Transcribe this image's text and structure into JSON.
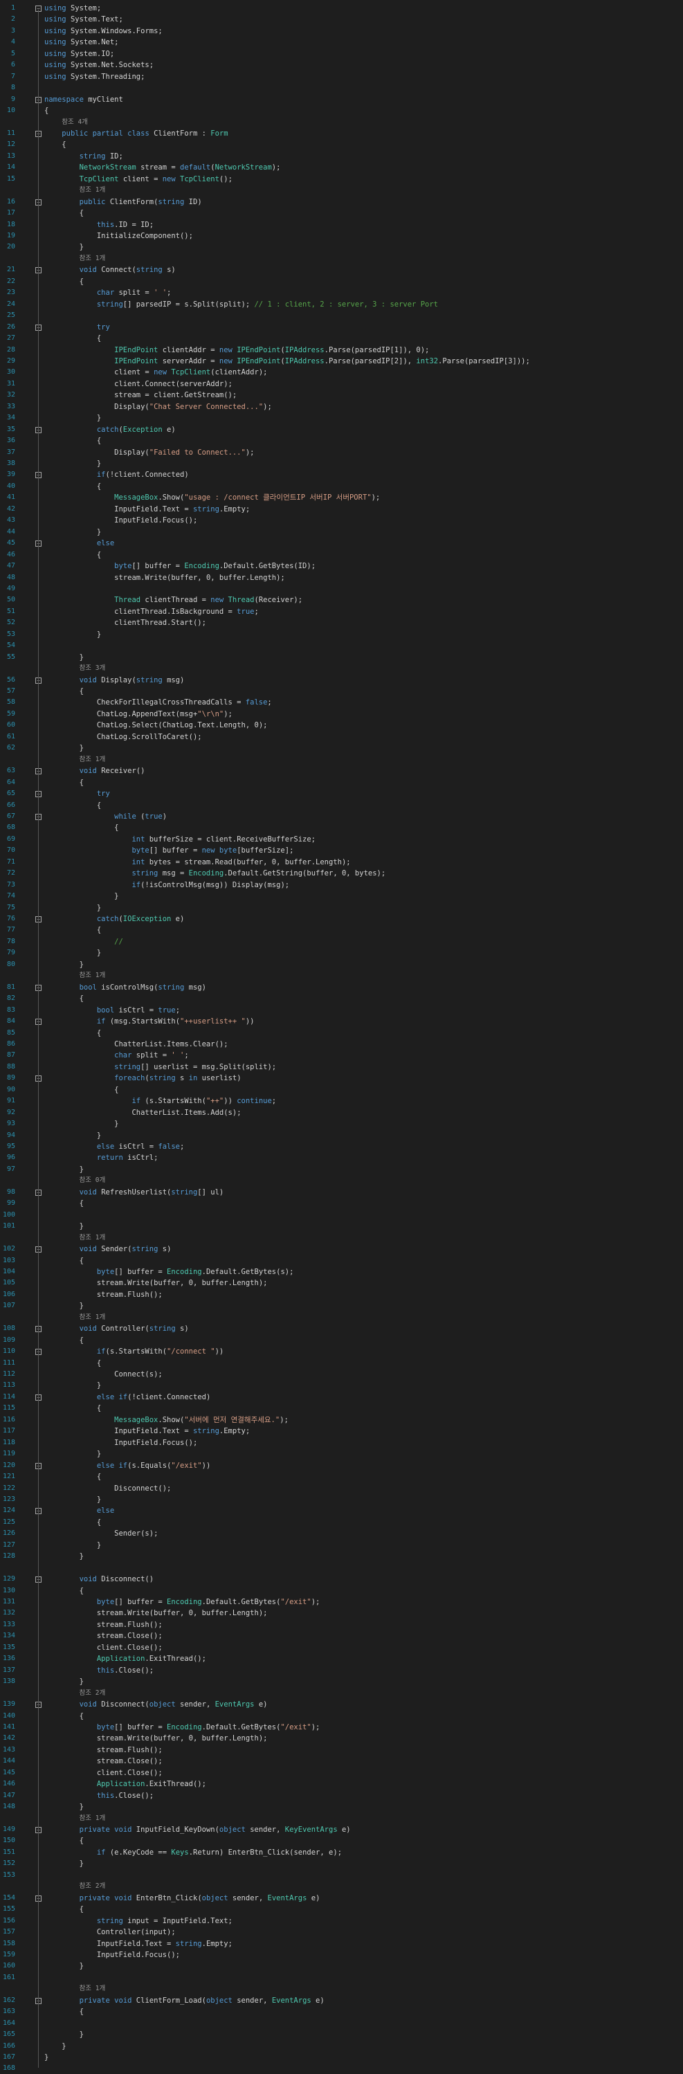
{
  "editor": {
    "colors": {
      "background": "#1e1e1e",
      "line_number": "#2b91af",
      "keyword": "#569cd6",
      "type": "#4ec9b0",
      "string": "#d69d85",
      "comment": "#57a64a",
      "method": "#dcdcaa",
      "text": "#d4d4d4",
      "ref_hint": "#999999"
    },
    "lines": [
      {
        "n": "1",
        "fold": "minus",
        "code": "using System;"
      },
      {
        "n": "2",
        "code": "using System.Text;"
      },
      {
        "n": "3",
        "code": "using System.Windows.Forms;"
      },
      {
        "n": "4",
        "code": "using System.Net;"
      },
      {
        "n": "5",
        "code": "using System.IO;"
      },
      {
        "n": "6",
        "code": "using System.Net.Sockets;"
      },
      {
        "n": "7",
        "code": "using System.Threading;"
      },
      {
        "n": "8",
        "code": ""
      },
      {
        "n": "9",
        "fold": "minus",
        "code": "namespace myClient"
      },
      {
        "n": "10",
        "code": "{"
      },
      {
        "n": "",
        "ref": "참조 4개",
        "indent": 1
      },
      {
        "n": "11",
        "fold": "minus",
        "code": "    public partial class ClientForm : Form"
      },
      {
        "n": "12",
        "code": "    {"
      },
      {
        "n": "13",
        "code": "        string ID;"
      },
      {
        "n": "14",
        "code": "        NetworkStream stream = default(NetworkStream);"
      },
      {
        "n": "15",
        "code": "        TcpClient client = new TcpClient();"
      },
      {
        "n": "",
        "ref": "참조 1개",
        "indent": 2
      },
      {
        "n": "16",
        "fold": "minus",
        "code": "        public ClientForm(string ID)"
      },
      {
        "n": "17",
        "code": "        {"
      },
      {
        "n": "18",
        "code": "            this.ID = ID;"
      },
      {
        "n": "19",
        "code": "            InitializeComponent();"
      },
      {
        "n": "20",
        "code": "        }"
      },
      {
        "n": "",
        "ref": "참조 1개",
        "indent": 2
      },
      {
        "n": "21",
        "fold": "minus",
        "code": "        void Connect(string s)"
      },
      {
        "n": "22",
        "code": "        {"
      },
      {
        "n": "23",
        "code": "            char split = ' ';"
      },
      {
        "n": "24",
        "code": "            string[] parsedIP = s.Split(split); // 1 : client, 2 : server, 3 : server Port"
      },
      {
        "n": "25",
        "code": ""
      },
      {
        "n": "26",
        "fold": "minus",
        "code": "            try"
      },
      {
        "n": "27",
        "code": "            {"
      },
      {
        "n": "28",
        "code": "                IPEndPoint clientAddr = new IPEndPoint(IPAddress.Parse(parsedIP[1]), 0);"
      },
      {
        "n": "29",
        "code": "                IPEndPoint serverAddr = new IPEndPoint(IPAddress.Parse(parsedIP[2]), int32.Parse(parsedIP[3]));"
      },
      {
        "n": "30",
        "code": "                client = new TcpClient(clientAddr);"
      },
      {
        "n": "31",
        "code": "                client.Connect(serverAddr);"
      },
      {
        "n": "32",
        "code": "                stream = client.GetStream();"
      },
      {
        "n": "33",
        "code": "                Display(\"Chat Server Connected...\");"
      },
      {
        "n": "34",
        "code": "            }"
      },
      {
        "n": "35",
        "fold": "minus",
        "code": "            catch(Exception e)"
      },
      {
        "n": "36",
        "code": "            {"
      },
      {
        "n": "37",
        "code": "                Display(\"Failed to Connect...\");"
      },
      {
        "n": "38",
        "code": "            }"
      },
      {
        "n": "39",
        "fold": "minus",
        "code": "            if(!client.Connected)"
      },
      {
        "n": "40",
        "code": "            {"
      },
      {
        "n": "41",
        "code": "                MessageBox.Show(\"usage : /connect 클라이언트IP 서버IP 서버PORT\");"
      },
      {
        "n": "42",
        "code": "                InputField.Text = string.Empty;"
      },
      {
        "n": "43",
        "code": "                InputField.Focus();"
      },
      {
        "n": "44",
        "code": "            }"
      },
      {
        "n": "45",
        "fold": "minus",
        "code": "            else"
      },
      {
        "n": "46",
        "code": "            {"
      },
      {
        "n": "47",
        "code": "                byte[] buffer = Encoding.Default.GetBytes(ID);"
      },
      {
        "n": "48",
        "code": "                stream.Write(buffer, 0, buffer.Length);"
      },
      {
        "n": "49",
        "code": ""
      },
      {
        "n": "50",
        "code": "                Thread clientThread = new Thread(Receiver);"
      },
      {
        "n": "51",
        "code": "                clientThread.IsBackground = true;"
      },
      {
        "n": "52",
        "code": "                clientThread.Start();"
      },
      {
        "n": "53",
        "code": "            }"
      },
      {
        "n": "54",
        "code": ""
      },
      {
        "n": "55",
        "code": "        }"
      },
      {
        "n": "",
        "ref": "참조 3개",
        "indent": 2
      },
      {
        "n": "56",
        "fold": "minus",
        "code": "        void Display(string msg)"
      },
      {
        "n": "57",
        "code": "        {"
      },
      {
        "n": "58",
        "code": "            CheckForIllegalCrossThreadCalls = false;"
      },
      {
        "n": "59",
        "code": "            ChatLog.AppendText(msg+\"\\r\\n\");"
      },
      {
        "n": "60",
        "code": "            ChatLog.Select(ChatLog.Text.Length, 0);"
      },
      {
        "n": "61",
        "code": "            ChatLog.ScrollToCaret();"
      },
      {
        "n": "62",
        "code": "        }"
      },
      {
        "n": "",
        "ref": "참조 1개",
        "indent": 2
      },
      {
        "n": "63",
        "fold": "minus",
        "code": "        void Receiver()"
      },
      {
        "n": "64",
        "code": "        {"
      },
      {
        "n": "65",
        "fold": "minus",
        "code": "            try"
      },
      {
        "n": "66",
        "code": "            {"
      },
      {
        "n": "67",
        "fold": "minus",
        "code": "                while (true)"
      },
      {
        "n": "68",
        "code": "                {"
      },
      {
        "n": "69",
        "code": "                    int bufferSize = client.ReceiveBufferSize;"
      },
      {
        "n": "70",
        "code": "                    byte[] buffer = new byte[bufferSize];"
      },
      {
        "n": "71",
        "code": "                    int bytes = stream.Read(buffer, 0, buffer.Length);"
      },
      {
        "n": "72",
        "code": "                    string msg = Encoding.Default.GetString(buffer, 0, bytes);"
      },
      {
        "n": "73",
        "code": "                    if(!isControlMsg(msg)) Display(msg);"
      },
      {
        "n": "74",
        "code": "                }"
      },
      {
        "n": "75",
        "code": "            }"
      },
      {
        "n": "76",
        "fold": "minus",
        "code": "            catch(IOException e)"
      },
      {
        "n": "77",
        "code": "            {"
      },
      {
        "n": "78",
        "code": "                //"
      },
      {
        "n": "79",
        "code": "            }"
      },
      {
        "n": "80",
        "code": "        }"
      },
      {
        "n": "",
        "ref": "참조 1개",
        "indent": 2
      },
      {
        "n": "81",
        "fold": "minus",
        "code": "        bool isControlMsg(string msg)"
      },
      {
        "n": "82",
        "code": "        {"
      },
      {
        "n": "83",
        "code": "            bool isCtrl = true;"
      },
      {
        "n": "84",
        "fold": "minus",
        "code": "            if (msg.StartsWith(\"++userlist++ \"))"
      },
      {
        "n": "85",
        "code": "            {"
      },
      {
        "n": "86",
        "code": "                ChatterList.Items.Clear();"
      },
      {
        "n": "87",
        "code": "                char split = ' ';"
      },
      {
        "n": "88",
        "code": "                string[] userlist = msg.Split(split);"
      },
      {
        "n": "89",
        "fold": "minus",
        "code": "                foreach(string s in userlist)"
      },
      {
        "n": "90",
        "code": "                {"
      },
      {
        "n": "91",
        "code": "                    if (s.StartsWith(\"++\")) continue;"
      },
      {
        "n": "92",
        "code": "                    ChatterList.Items.Add(s);"
      },
      {
        "n": "93",
        "code": "                }"
      },
      {
        "n": "94",
        "code": "            }"
      },
      {
        "n": "95",
        "code": "            else isCtrl = false;"
      },
      {
        "n": "96",
        "code": "            return isCtrl;"
      },
      {
        "n": "97",
        "code": "        }"
      },
      {
        "n": "",
        "ref": "참조 0개",
        "indent": 2
      },
      {
        "n": "98",
        "fold": "minus",
        "code": "        void RefreshUserlist(string[] ul)"
      },
      {
        "n": "99",
        "code": "        {"
      },
      {
        "n": "100",
        "code": ""
      },
      {
        "n": "101",
        "code": "        }"
      },
      {
        "n": "",
        "ref": "참조 1개",
        "indent": 2
      },
      {
        "n": "102",
        "fold": "minus",
        "code": "        void Sender(string s)"
      },
      {
        "n": "103",
        "code": "        {"
      },
      {
        "n": "104",
        "code": "            byte[] buffer = Encoding.Default.GetBytes(s);"
      },
      {
        "n": "105",
        "code": "            stream.Write(buffer, 0, buffer.Length);"
      },
      {
        "n": "106",
        "code": "            stream.Flush();"
      },
      {
        "n": "107",
        "code": "        }"
      },
      {
        "n": "",
        "ref": "참조 1개",
        "indent": 2
      },
      {
        "n": "108",
        "fold": "minus",
        "code": "        void Controller(string s)"
      },
      {
        "n": "109",
        "code": "        {"
      },
      {
        "n": "110",
        "fold": "minus",
        "code": "            if(s.StartsWith(\"/connect \"))"
      },
      {
        "n": "111",
        "code": "            {"
      },
      {
        "n": "112",
        "code": "                Connect(s);"
      },
      {
        "n": "113",
        "code": "            }"
      },
      {
        "n": "114",
        "fold": "minus",
        "code": "            else if(!client.Connected)"
      },
      {
        "n": "115",
        "code": "            {"
      },
      {
        "n": "116",
        "code": "                MessageBox.Show(\"서버에 먼저 연결해주세요.\");"
      },
      {
        "n": "117",
        "code": "                InputField.Text = string.Empty;"
      },
      {
        "n": "118",
        "code": "                InputField.Focus();"
      },
      {
        "n": "119",
        "code": "            }"
      },
      {
        "n": "120",
        "fold": "minus",
        "code": "            else if(s.Equals(\"/exit\"))"
      },
      {
        "n": "121",
        "code": "            {"
      },
      {
        "n": "122",
        "code": "                Disconnect();"
      },
      {
        "n": "123",
        "code": "            }"
      },
      {
        "n": "124",
        "fold": "minus",
        "code": "            else"
      },
      {
        "n": "125",
        "code": "            {"
      },
      {
        "n": "126",
        "code": "                Sender(s);"
      },
      {
        "n": "127",
        "code": "            }"
      },
      {
        "n": "128",
        "code": "        }"
      },
      {
        "n": "",
        "ref": "",
        "indent": 2
      },
      {
        "n": "129",
        "fold": "minus",
        "code": "        void Disconnect()"
      },
      {
        "n": "130",
        "code": "        {"
      },
      {
        "n": "131",
        "code": "            byte[] buffer = Encoding.Default.GetBytes(\"/exit\");"
      },
      {
        "n": "132",
        "code": "            stream.Write(buffer, 0, buffer.Length);"
      },
      {
        "n": "133",
        "code": "            stream.Flush();"
      },
      {
        "n": "134",
        "code": "            stream.Close();"
      },
      {
        "n": "135",
        "code": "            client.Close();"
      },
      {
        "n": "136",
        "code": "            Application.ExitThread();"
      },
      {
        "n": "137",
        "code": "            this.Close();"
      },
      {
        "n": "138",
        "code": "        }"
      },
      {
        "n": "",
        "ref": "참조 2개",
        "indent": 2
      },
      {
        "n": "139",
        "fold": "minus",
        "code": "        void Disconnect(object sender, EventArgs e)"
      },
      {
        "n": "140",
        "code": "        {"
      },
      {
        "n": "141",
        "code": "            byte[] buffer = Encoding.Default.GetBytes(\"/exit\");"
      },
      {
        "n": "142",
        "code": "            stream.Write(buffer, 0, buffer.Length);"
      },
      {
        "n": "143",
        "code": "            stream.Flush();"
      },
      {
        "n": "144",
        "code": "            stream.Close();"
      },
      {
        "n": "145",
        "code": "            client.Close();"
      },
      {
        "n": "146",
        "code": "            Application.ExitThread();"
      },
      {
        "n": "147",
        "code": "            this.Close();"
      },
      {
        "n": "148",
        "code": "        }"
      },
      {
        "n": "",
        "ref": "참조 1개",
        "indent": 2
      },
      {
        "n": "149",
        "fold": "minus",
        "code": "        private void InputField_KeyDown(object sender, KeyEventArgs e)"
      },
      {
        "n": "150",
        "code": "        {"
      },
      {
        "n": "151",
        "code": "            if (e.KeyCode == Keys.Return) EnterBtn_Click(sender, e);"
      },
      {
        "n": "152",
        "code": "        }"
      },
      {
        "n": "153",
        "code": ""
      },
      {
        "n": "",
        "ref": "참조 2개",
        "indent": 2
      },
      {
        "n": "154",
        "fold": "minus",
        "code": "        private void EnterBtn_Click(object sender, EventArgs e)"
      },
      {
        "n": "155",
        "code": "        {"
      },
      {
        "n": "156",
        "code": "            string input = InputField.Text;"
      },
      {
        "n": "157",
        "code": "            Controller(input);"
      },
      {
        "n": "158",
        "code": "            InputField.Text = string.Empty;"
      },
      {
        "n": "159",
        "code": "            InputField.Focus();"
      },
      {
        "n": "160",
        "code": "        }"
      },
      {
        "n": "161",
        "code": ""
      },
      {
        "n": "",
        "ref": "참조 1개",
        "indent": 2
      },
      {
        "n": "162",
        "fold": "minus",
        "code": "        private void ClientForm_Load(object sender, EventArgs e)"
      },
      {
        "n": "163",
        "code": "        {"
      },
      {
        "n": "164",
        "code": ""
      },
      {
        "n": "165",
        "code": "        }"
      },
      {
        "n": "166",
        "code": "    }"
      },
      {
        "n": "167",
        "code": "}"
      },
      {
        "n": "168",
        "code": ""
      }
    ]
  }
}
